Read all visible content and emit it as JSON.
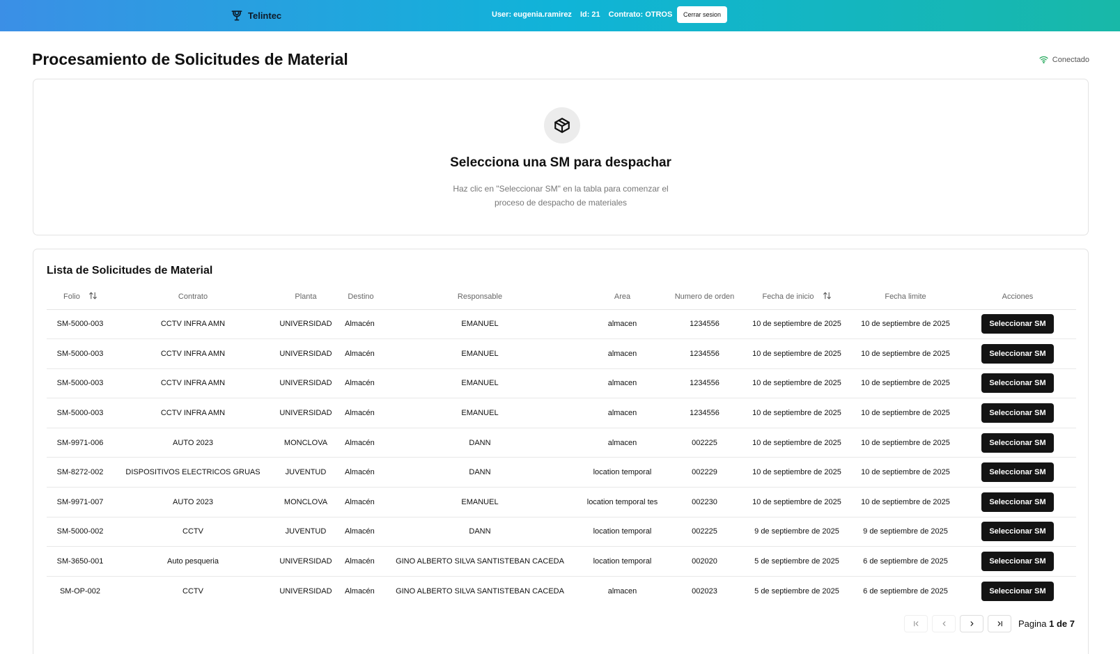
{
  "header": {
    "brand": "Telintec",
    "user": "User: eugenia.ramirez",
    "id": "Id: 21",
    "contract": "Contrato: OTROS",
    "logout_label": "Cerrar sesion"
  },
  "page": {
    "title": "Procesamiento de Solicitudes de Material",
    "status": "Conectado"
  },
  "empty_state": {
    "title": "Selecciona una SM para despachar",
    "line1": "Haz clic en \"Seleccionar SM\" en la tabla para comenzar el",
    "line2": "proceso de despacho de materiales"
  },
  "list": {
    "title": "Lista de Solicitudes de Material",
    "columns": {
      "folio": "Folio",
      "contrato": "Contrato",
      "planta": "Planta",
      "destino": "Destino",
      "responsable": "Responsable",
      "area": "Area",
      "orden": "Numero de orden",
      "inicio": "Fecha de inicio",
      "limite": "Fecha limite",
      "acciones": "Acciones"
    },
    "action_label": "Seleccionar SM",
    "rows": [
      {
        "folio": "SM-5000-003",
        "contrato": "CCTV INFRA AMN",
        "planta": "UNIVERSIDAD",
        "destino": "Almacén",
        "responsable": "EMANUEL",
        "area": "almacen",
        "orden": "1234556",
        "inicio": "10 de septiembre de 2025",
        "limite": "10 de septiembre de 2025"
      },
      {
        "folio": "SM-5000-003",
        "contrato": "CCTV INFRA AMN",
        "planta": "UNIVERSIDAD",
        "destino": "Almacén",
        "responsable": "EMANUEL",
        "area": "almacen",
        "orden": "1234556",
        "inicio": "10 de septiembre de 2025",
        "limite": "10 de septiembre de 2025"
      },
      {
        "folio": "SM-5000-003",
        "contrato": "CCTV INFRA AMN",
        "planta": "UNIVERSIDAD",
        "destino": "Almacén",
        "responsable": "EMANUEL",
        "area": "almacen",
        "orden": "1234556",
        "inicio": "10 de septiembre de 2025",
        "limite": "10 de septiembre de 2025"
      },
      {
        "folio": "SM-5000-003",
        "contrato": "CCTV INFRA AMN",
        "planta": "UNIVERSIDAD",
        "destino": "Almacén",
        "responsable": "EMANUEL",
        "area": "almacen",
        "orden": "1234556",
        "inicio": "10 de septiembre de 2025",
        "limite": "10 de septiembre de 2025"
      },
      {
        "folio": "SM-9971-006",
        "contrato": "AUTO 2023",
        "planta": "MONCLOVA",
        "destino": "Almacén",
        "responsable": "DANN",
        "area": "almacen",
        "orden": "002225",
        "inicio": "10 de septiembre de 2025",
        "limite": "10 de septiembre de 2025"
      },
      {
        "folio": "SM-8272-002",
        "contrato": "DISPOSITIVOS ELECTRICOS GRUAS",
        "planta": "JUVENTUD",
        "destino": "Almacén",
        "responsable": "DANN",
        "area": "location temporal",
        "orden": "002229",
        "inicio": "10 de septiembre de 2025",
        "limite": "10 de septiembre de 2025"
      },
      {
        "folio": "SM-9971-007",
        "contrato": "AUTO 2023",
        "planta": "MONCLOVA",
        "destino": "Almacén",
        "responsable": "EMANUEL",
        "area": "location temporal tes",
        "orden": "002230",
        "inicio": "10 de septiembre de 2025",
        "limite": "10 de septiembre de 2025"
      },
      {
        "folio": "SM-5000-002",
        "contrato": "CCTV",
        "planta": "JUVENTUD",
        "destino": "Almacén",
        "responsable": "DANN",
        "area": "location temporal",
        "orden": "002225",
        "inicio": "9 de septiembre de 2025",
        "limite": "9 de septiembre de 2025"
      },
      {
        "folio": "SM-3650-001",
        "contrato": "Auto pesqueria",
        "planta": "UNIVERSIDAD",
        "destino": "Almacén",
        "responsable": "GINO ALBERTO SILVA SANTISTEBAN CACEDA",
        "area": "location temporal",
        "orden": "002020",
        "inicio": "5 de septiembre de 2025",
        "limite": "6 de septiembre de 2025"
      },
      {
        "folio": "SM-OP-002",
        "contrato": "CCTV",
        "planta": "UNIVERSIDAD",
        "destino": "Almacén",
        "responsable": "GINO ALBERTO SILVA SANTISTEBAN CACEDA",
        "area": "almacen",
        "orden": "002023",
        "inicio": "5 de septiembre de 2025",
        "limite": "6 de septiembre de 2025"
      }
    ]
  },
  "pagination": {
    "prefix": "Pagina",
    "current": "1",
    "separator": "de",
    "total": "7"
  },
  "icons": {
    "brand": "broadcast-tower-icon",
    "status": "wifi-icon",
    "empty": "package-icon",
    "sort": "sort-arrows-icon"
  },
  "colors": {
    "header_gradient_start": "#3b8fe6",
    "header_gradient_end": "#18b8a8",
    "action_button": "#141414",
    "status_wifi": "#22a85a"
  }
}
